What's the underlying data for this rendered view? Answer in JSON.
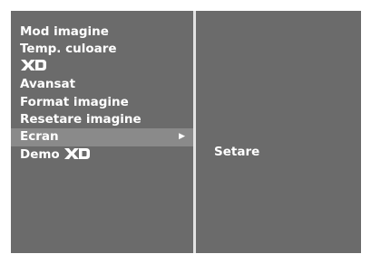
{
  "menu": {
    "items": [
      {
        "label": "Mod imagine"
      },
      {
        "label": "Temp. culoare"
      },
      {
        "label": "",
        "logo": "XD"
      },
      {
        "label": "Avansat"
      },
      {
        "label": "Format imagine"
      },
      {
        "label": "Resetare imagine"
      },
      {
        "label": "Ecran",
        "selected": true,
        "icon": "arrow-right-icon"
      },
      {
        "label": "Demo",
        "logo": "XD"
      }
    ]
  },
  "submenu": {
    "value": "Setare"
  },
  "colors": {
    "panel": "#6b6b6b",
    "highlight": "#8a8a8a",
    "divider": "#e3e3e3",
    "text": "#ffffff"
  }
}
